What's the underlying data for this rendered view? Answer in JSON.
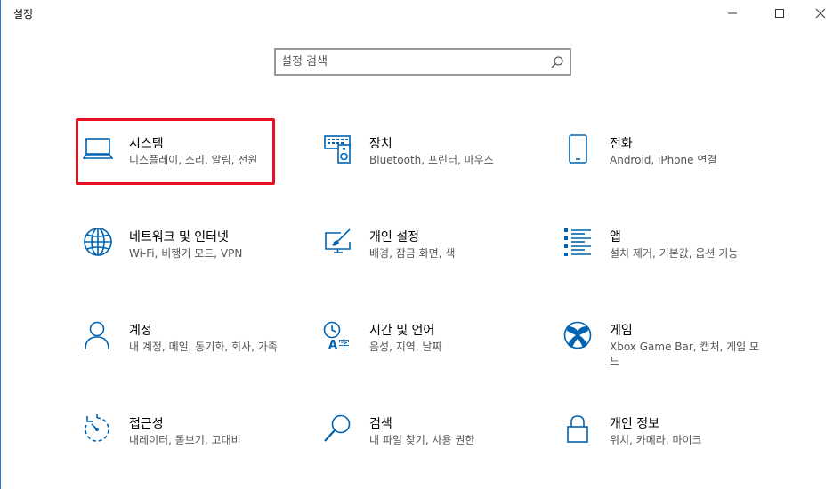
{
  "window": {
    "title": "설정"
  },
  "search": {
    "placeholder": "설정 검색"
  },
  "tiles": [
    {
      "name": "시스템",
      "desc": "디스플레이, 소리, 알림, 전원",
      "icon": "laptop-icon"
    },
    {
      "name": "장치",
      "desc": "Bluetooth, 프린터, 마우스",
      "icon": "keyboard-speaker-icon"
    },
    {
      "name": "전화",
      "desc": "Android, iPhone 연결",
      "icon": "phone-icon"
    },
    {
      "name": "네트워크 및 인터넷",
      "desc": "Wi-Fi, 비행기 모드, VPN",
      "icon": "globe-icon"
    },
    {
      "name": "개인 설정",
      "desc": "배경, 잠금 화면, 색",
      "icon": "paint-monitor-icon"
    },
    {
      "name": "앱",
      "desc": "설치 제거, 기본값, 옵션 기능",
      "icon": "app-list-icon"
    },
    {
      "name": "계정",
      "desc": "내 계정, 메일, 동기화, 회사, 가족",
      "icon": "person-icon"
    },
    {
      "name": "시간 및 언어",
      "desc": "음성, 지역, 날짜",
      "icon": "time-language-icon"
    },
    {
      "name": "게임",
      "desc": "Xbox Game Bar, 캡처, 게임 모드",
      "icon": "xbox-icon"
    },
    {
      "name": "접근성",
      "desc": "내레이터, 돋보기, 고대비",
      "icon": "accessibility-timer-icon"
    },
    {
      "name": "검색",
      "desc": "내 파일 찾기, 사용 권한",
      "icon": "magnifier-icon"
    },
    {
      "name": "개인 정보",
      "desc": "위치, 카메라, 마이크",
      "icon": "lock-icon"
    }
  ],
  "highlight_color": "#e81123",
  "accent_color": "#0063b1"
}
